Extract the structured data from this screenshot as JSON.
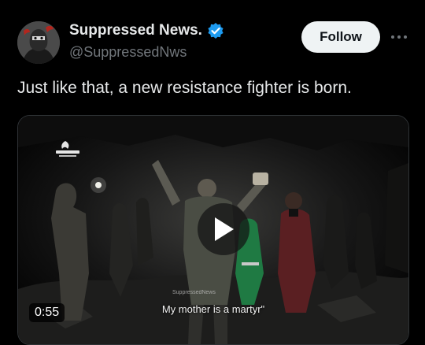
{
  "author": {
    "display_name": "Suppressed News.",
    "handle": "@SuppressedNws",
    "verified_icon": "verified-badge-icon",
    "verified_color": "#1d9bf0"
  },
  "actions": {
    "follow_label": "Follow",
    "more_icon": "more-options-icon"
  },
  "tweet": {
    "text": "Just like that, a new resistance fighter is born."
  },
  "video": {
    "duration": "0:55",
    "caption": "My mother is a martyr\"",
    "watermark_small": "SuppressedNews",
    "play_icon": "play-icon"
  },
  "colors": {
    "background": "#000000",
    "text_primary": "#e7e9ea",
    "text_secondary": "#71767b",
    "follow_bg": "#eff3f4",
    "follow_text": "#0f1419"
  }
}
